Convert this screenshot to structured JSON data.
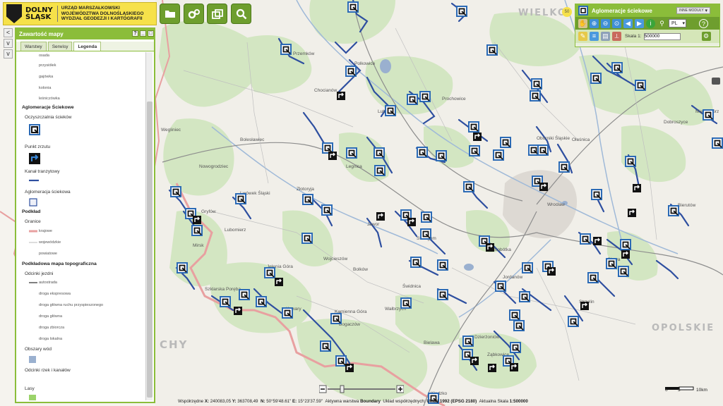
{
  "header": {
    "logo_title_1": "DOLNY",
    "logo_title_2": "ŚLĄSK",
    "logo_sub_1": "URZĄD MARSZAŁKOWSKI",
    "logo_sub_2": "WOJEWÓDZTWA DOLNOŚLĄSKIEGO",
    "logo_sub_3": "WYDZIAŁ GEODEZJI I KARTOGRAFII",
    "toolbar_icons": [
      "folder-icon",
      "gear-icon",
      "windows-icon",
      "search-icon"
    ]
  },
  "panel": {
    "title": "Zawartość mapy",
    "controls": [
      "?",
      "_",
      "□"
    ],
    "tabs": [
      "Warstwy",
      "Serwisy",
      "Legenda"
    ],
    "active_tab": "Legenda",
    "legend_top_items": [
      "osada",
      "przysiółek",
      "gajówka",
      "kolonia",
      "leśniczówka"
    ],
    "aglo_head": "Aglomeracje Ściekowe",
    "aglo_items": [
      "Oczyszczalnia ścieków",
      "Punkt zrzutu",
      "Kanał tranzytowy",
      "Aglomeracja ściekowa"
    ],
    "podklad_head": "Podkład",
    "granice_label": "Granice",
    "granice_items": [
      "krajowe",
      "wojewódzkie",
      "powiatowe"
    ],
    "topo_head": "Podkładowa mapa topograficzna",
    "roads_label": "Odcinki jezdni",
    "roads_items": [
      "autostrada",
      "droga ekspresowa",
      "droga główna ruchu przyspieszonego",
      "droga główna",
      "droga zbiorcza",
      "droga lokalna"
    ],
    "water_label": "Obszary wód",
    "rivers_label": "Odcinki rzek i kanałów",
    "forest_label": "Lasy"
  },
  "module": {
    "title": "Aglomeracje ściekowe",
    "other_modules": "INNE MODUŁY",
    "lang": "PL",
    "scale_label": "Skala 1:",
    "scale_value": "500000"
  },
  "map": {
    "region_labels": [
      "WIELKO",
      "OPOLSKIE",
      "CHY"
    ],
    "places": [
      "Przemków",
      "Chocianów",
      "Polkowice",
      "Lubin",
      "Prochowice",
      "Oborniki Śląskie",
      "Oleśnica",
      "Bolesławiec",
      "Nowogrodziec",
      "Lwówek Śląski",
      "Złotoryja",
      "Jawor",
      "Legnica",
      "Strzegom",
      "Wrocław",
      "Jelenia Góra",
      "Kowary",
      "Świdnica",
      "Wałbrzych",
      "Kamienna Góra",
      "Bogaczów",
      "Strzelin",
      "Oława",
      "Ząbkowice",
      "Bielawa",
      "Dzierżoniów",
      "Mirsk",
      "Lubomierz",
      "Gryfów",
      "Kłodzko",
      "Bierutów",
      "Międzybórz",
      "Dobroszyce",
      "Wegliniec",
      "Szklarska Poręba",
      "Bolków",
      "Wojcieszów",
      "Sobótka",
      "Jordanów"
    ]
  },
  "statusbar": {
    "coords_label": "Współrzędne",
    "x_label": "X:",
    "x_value": "240083,05",
    "y_label": "Y:",
    "y_value": "363708,49",
    "n_label": "N:",
    "n_value": "50°59'48.61\"",
    "e_label": "E:",
    "e_value": "15°23'37.59\"",
    "active_layer_label": "Aktywna warstwa",
    "active_layer_value": "Boundary",
    "crs_label": "Układ współrzędnych:",
    "crs_value": "Układ 1992 (EPSG 2180)",
    "scale_label": "Aktualna Skala",
    "scale_value": "1:500000"
  },
  "scalebar": {
    "ticks": [
      "0",
      "5",
      "10km"
    ]
  }
}
